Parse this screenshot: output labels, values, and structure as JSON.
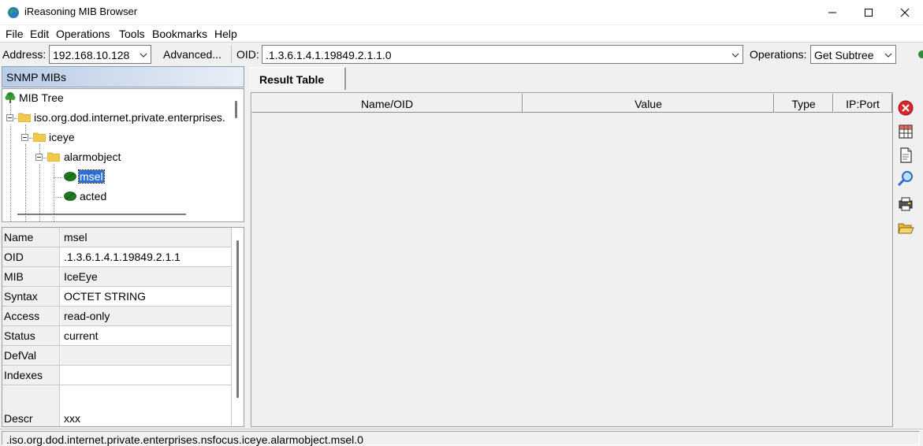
{
  "window": {
    "title": "iReasoning MIB Browser"
  },
  "menu": [
    "File",
    "Edit",
    "Operations",
    "Tools",
    "Bookmarks",
    "Help"
  ],
  "toolbar": {
    "address_label": "Address:",
    "address_value": "192.168.10.128",
    "advanced_label": "Advanced...",
    "oid_label": "OID:",
    "oid_value": ".1.3.6.1.4.1.19849.2.1.1.0",
    "operations_label": "Operations:",
    "operations_value": "Get Subtree"
  },
  "left_panel": {
    "header": "SNMP MIBs",
    "tree": [
      {
        "label": "MIB Tree",
        "icon": "tree-icon",
        "selected": false
      },
      {
        "label": "iso.org.dod.internet.private.enterprises.",
        "icon": "folder-icon",
        "selected": false
      },
      {
        "label": "iceye",
        "icon": "folder-icon",
        "selected": false
      },
      {
        "label": "alarmobject",
        "icon": "folder-icon",
        "selected": false
      },
      {
        "label": "msel",
        "icon": "leaf-icon",
        "selected": true
      },
      {
        "label": "acted",
        "icon": "leaf-icon",
        "selected": false
      }
    ],
    "properties": [
      {
        "key": "Name",
        "value": "msel"
      },
      {
        "key": "OID",
        "value": ".1.3.6.1.4.1.19849.2.1.1"
      },
      {
        "key": "MIB",
        "value": "IceEye"
      },
      {
        "key": "Syntax",
        "value": "OCTET STRING"
      },
      {
        "key": "Access",
        "value": "read-only"
      },
      {
        "key": "Status",
        "value": "current"
      },
      {
        "key": "DefVal",
        "value": ""
      },
      {
        "key": "Indexes",
        "value": ""
      },
      {
        "key": "Descr",
        "value": "xxx"
      }
    ]
  },
  "result": {
    "tab_label": "Result Table",
    "columns": [
      "Name/OID",
      "Value",
      "Type",
      "IP:Port"
    ]
  },
  "side_tools": [
    "close-red-icon",
    "table-grid-icon",
    "document-icon",
    "magnifier-icon",
    "print-icon",
    "open-folder-icon"
  ],
  "status": {
    "text": ".iso.org.dod.internet.private.enterprises.nsfocus.iceye.alarmobject.msel.0"
  },
  "colors": {
    "selection": "#2f6fd0",
    "header_gradient_start": "#b8cde6",
    "close_icon_red": "#d9262b"
  }
}
